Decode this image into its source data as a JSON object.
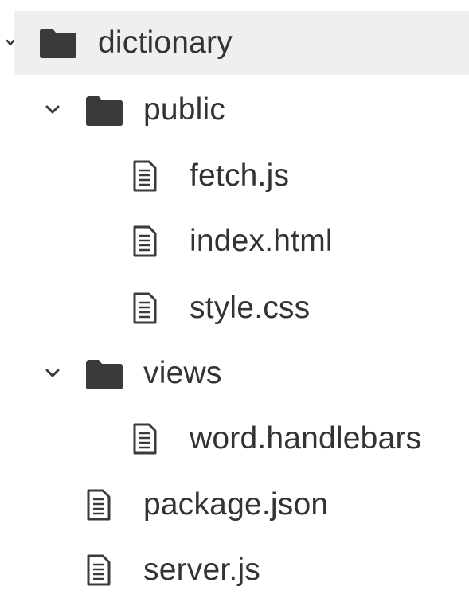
{
  "tree": {
    "root": {
      "label": "dictionary",
      "icon": "folder-icon",
      "expanded": true
    },
    "items": [
      {
        "label": "public",
        "icon": "folder-icon",
        "expanded": true
      },
      {
        "label": "fetch.js",
        "icon": "file-icon"
      },
      {
        "label": "index.html",
        "icon": "file-icon"
      },
      {
        "label": "style.css",
        "icon": "file-icon"
      },
      {
        "label": "views",
        "icon": "folder-icon",
        "expanded": true
      },
      {
        "label": "word.handlebars",
        "icon": "file-icon"
      },
      {
        "label": "package.json",
        "icon": "file-icon"
      },
      {
        "label": "server.js",
        "icon": "file-icon"
      }
    ]
  },
  "colors": {
    "text": "#333333",
    "folder": "#3a3a3a",
    "file_stroke": "#3a3a3a",
    "selected_row_bg": "#efefef"
  }
}
